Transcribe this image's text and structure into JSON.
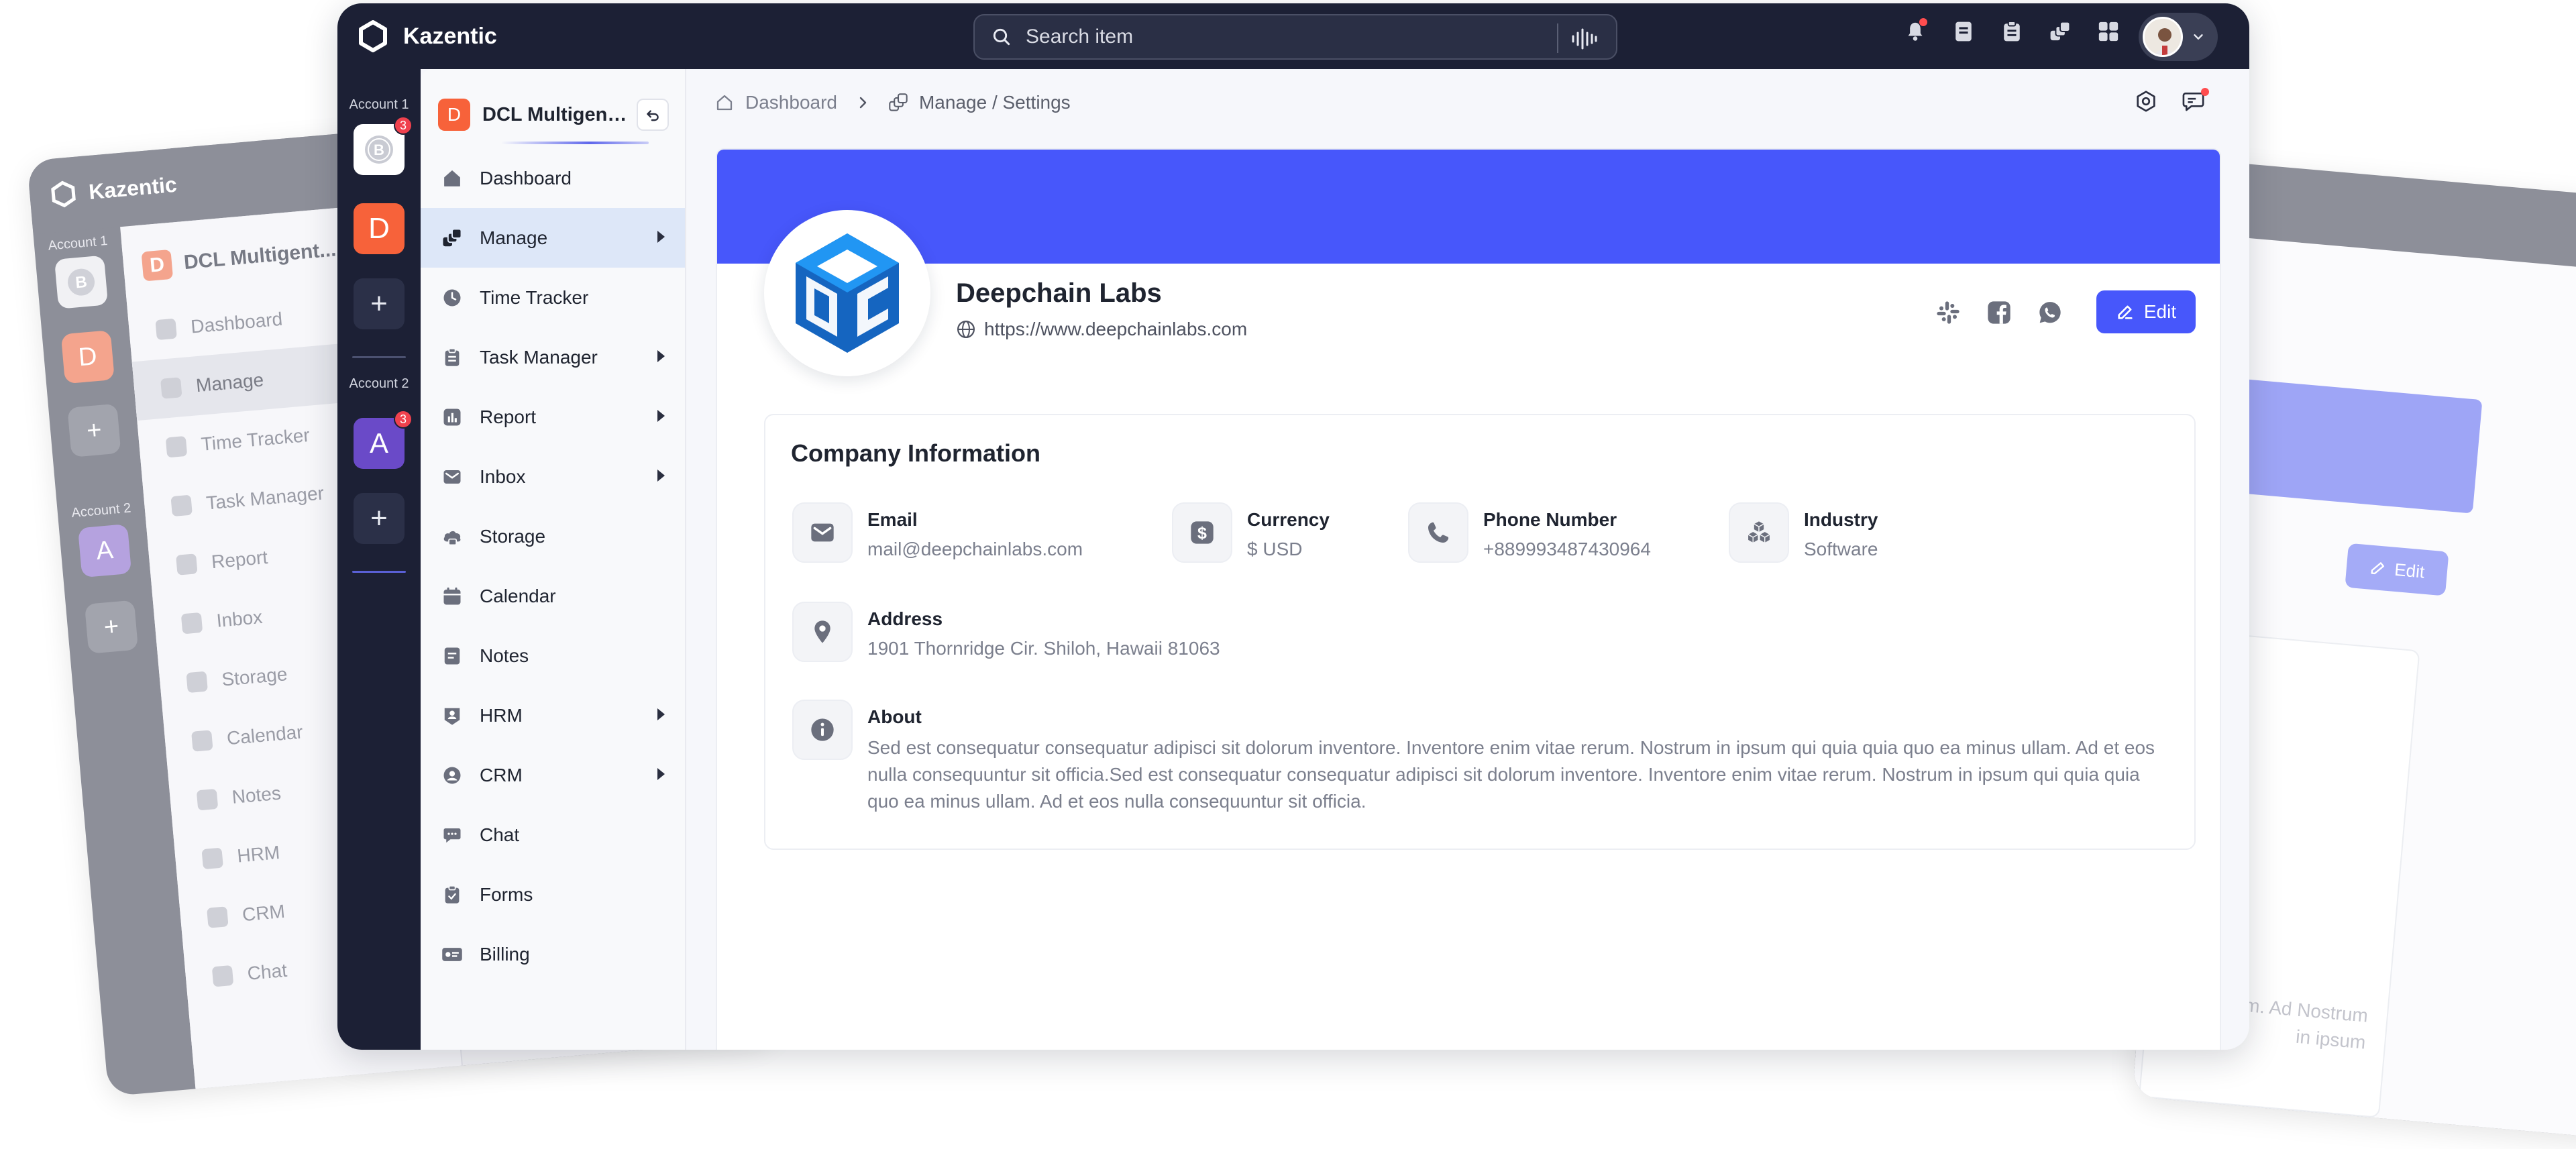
{
  "app": {
    "name": "Kazentic"
  },
  "search": {
    "placeholder": "Search item"
  },
  "accounts": [
    {
      "label": "Account 1",
      "badge": "3",
      "letter": ""
    },
    {
      "label": "Account 2",
      "badge": "3",
      "letter": "A"
    }
  ],
  "workspace": {
    "letter": "D",
    "name": "DCL Multigent...",
    "rail_letter": "D"
  },
  "nav": [
    {
      "label": "Dashboard",
      "icon": "home-icon",
      "has_submenu": false
    },
    {
      "label": "Manage",
      "icon": "manage-icon",
      "has_submenu": true,
      "active": true
    },
    {
      "label": "Time Tracker",
      "icon": "clock-icon",
      "has_submenu": false
    },
    {
      "label": "Task Manager",
      "icon": "clipboard-icon",
      "has_submenu": true
    },
    {
      "label": "Report",
      "icon": "report-icon",
      "has_submenu": true
    },
    {
      "label": "Inbox",
      "icon": "mail-icon",
      "has_submenu": true
    },
    {
      "label": "Storage",
      "icon": "cloud-icon",
      "has_submenu": false
    },
    {
      "label": "Calendar",
      "icon": "calendar-icon",
      "has_submenu": false
    },
    {
      "label": "Notes",
      "icon": "notes-icon",
      "has_submenu": false
    },
    {
      "label": "HRM",
      "icon": "hrm-icon",
      "has_submenu": true
    },
    {
      "label": "CRM",
      "icon": "crm-icon",
      "has_submenu": true
    },
    {
      "label": "Chat",
      "icon": "chat-icon",
      "has_submenu": false
    },
    {
      "label": "Forms",
      "icon": "forms-icon",
      "has_submenu": false
    },
    {
      "label": "Billing",
      "icon": "billing-icon",
      "has_submenu": false
    }
  ],
  "breadcrumb": {
    "home": "Dashboard",
    "current": "Manage / Settings"
  },
  "company": {
    "name": "Deepchain Labs",
    "url": "https://www.deepchainlabs.com"
  },
  "edit_label": "Edit",
  "info": {
    "title": "Company Information",
    "email": {
      "label": "Email",
      "value": "mail@deepchainlabs.com"
    },
    "currency": {
      "label": "Currency",
      "value": "$ USD"
    },
    "phone": {
      "label": "Phone Number",
      "value": "+889993487430964"
    },
    "industry": {
      "label": "Industry",
      "value": "Software"
    },
    "address": {
      "label": "Address",
      "value": "1901 Thornridge Cir. Shiloh, Hawaii 81063"
    },
    "about": {
      "label": "About",
      "value": "Sed est consequatur consequatur adipisci sit dolorum inventore. Inventore enim vitae rerum. Nostrum in ipsum qui quia quia quo ea minus ullam. Ad et eos nulla consequuntur sit officia.Sed est consequatur consequatur adipisci sit dolorum inventore. Inventore enim vitae rerum. Nostrum in ipsum qui quia quia quo ea minus ullam. Ad et eos nulla consequuntur sit officia."
    }
  },
  "background": {
    "faded_text": "a minus ullam. Ad Nostrum in ipsum"
  },
  "colors": {
    "accent": "#4757fb",
    "dark": "#1c2035",
    "orange": "#f7623a",
    "purple": "#6a4ac8"
  }
}
